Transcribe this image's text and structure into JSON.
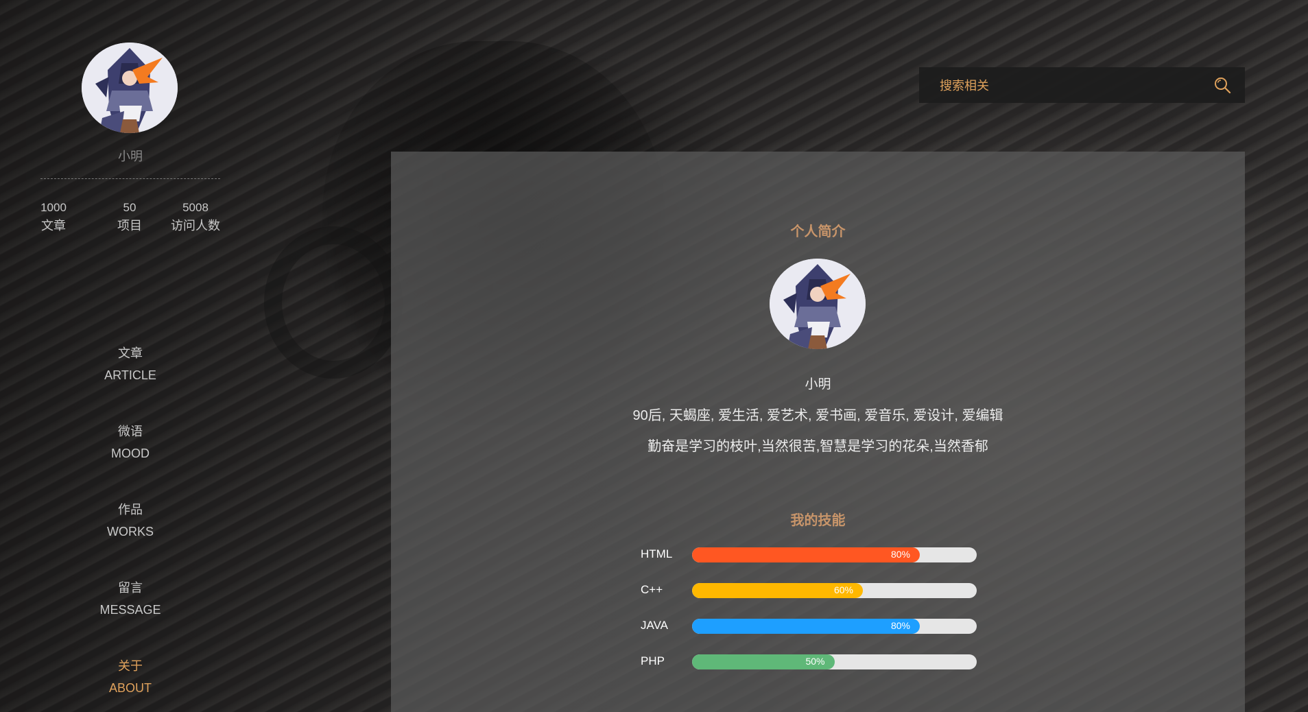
{
  "sidebar": {
    "name": "小明",
    "stats": [
      {
        "value": "1000",
        "label": "文章"
      },
      {
        "value": "50",
        "label": "项目"
      },
      {
        "value": "5008",
        "label": "访问人数"
      }
    ],
    "nav": [
      {
        "cn": "文章",
        "en": "ARTICLE",
        "active": false
      },
      {
        "cn": "微语",
        "en": "MOOD",
        "active": false
      },
      {
        "cn": "作品",
        "en": "WORKS",
        "active": false
      },
      {
        "cn": "留言",
        "en": "MESSAGE",
        "active": false
      },
      {
        "cn": "关于",
        "en": "ABOUT",
        "active": true
      }
    ]
  },
  "search": {
    "placeholder": "搜索相关",
    "icon": "search-icon"
  },
  "profile": {
    "section_title": "个人简介",
    "name": "小明",
    "bio_line1": "90后, 天蝎座, 爱生活, 爱艺术, 爱书画, 爱音乐, 爱设计, 爱编辑",
    "bio_line2": "勤奋是学习的枝叶,当然很苦,智慧是学习的花朵,当然香郁"
  },
  "skills": {
    "section_title": "我的技能",
    "items": [
      {
        "name": "HTML",
        "percent": 80,
        "label": "80%",
        "color": "#ff5722"
      },
      {
        "name": "C++",
        "percent": 60,
        "label": "60%",
        "color": "#ffb800"
      },
      {
        "name": "JAVA",
        "percent": 80,
        "label": "80%",
        "color": "#1e9fff"
      },
      {
        "name": "PHP",
        "percent": 50,
        "label": "50%",
        "color": "#5fb878"
      }
    ]
  },
  "colors": {
    "accent": "#e0a25c",
    "section_title": "#c8956a"
  }
}
